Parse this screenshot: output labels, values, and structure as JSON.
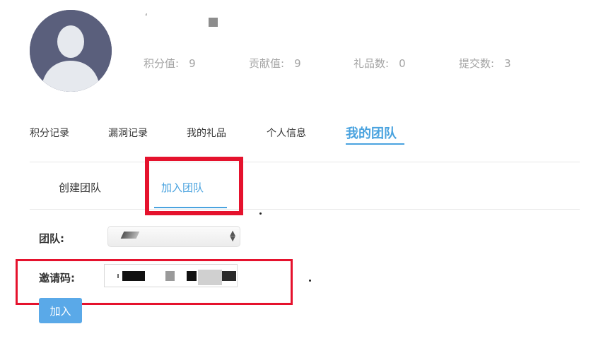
{
  "profile": {
    "stats": [
      {
        "label": "积分值:",
        "value": "9"
      },
      {
        "label": "贡献值:",
        "value": "9"
      },
      {
        "label": "礼品数:",
        "value": "0"
      },
      {
        "label": "提交数:",
        "value": "3"
      }
    ]
  },
  "main_tabs": [
    {
      "label": "积分记录"
    },
    {
      "label": "漏洞记录"
    },
    {
      "label": "我的礼品"
    },
    {
      "label": "个人信息"
    },
    {
      "label": "我的团队",
      "active": true
    }
  ],
  "sub_tabs": [
    {
      "label": "创建团队"
    },
    {
      "label": "加入团队",
      "active": true
    }
  ],
  "form": {
    "team_label": "团队:",
    "invite_label": "邀请码:",
    "join_button": "加入"
  },
  "colors": {
    "accent": "#4aa3df",
    "highlight_red": "#e5122d",
    "button_blue": "#5aa9e8"
  }
}
